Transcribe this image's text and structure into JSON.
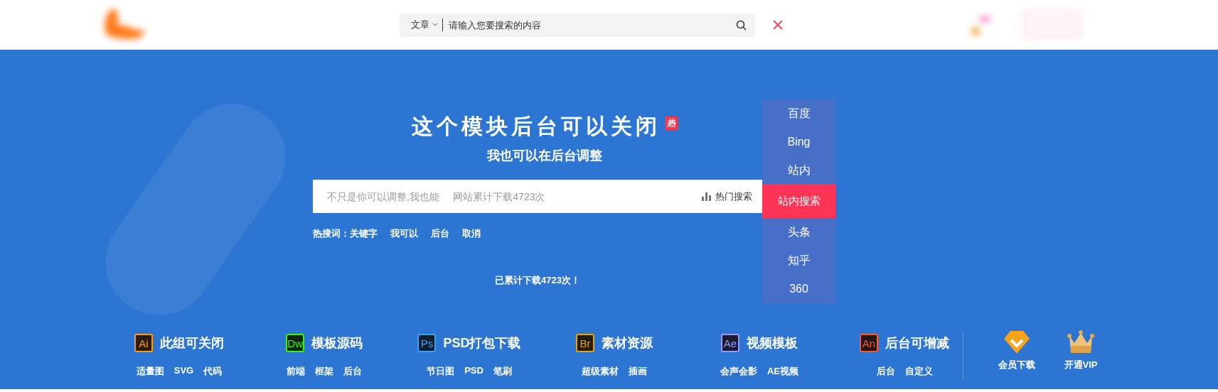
{
  "header": {
    "search": {
      "category": "文章",
      "placeholder": "请输入您要搜索的内容"
    }
  },
  "hero": {
    "title": "这个模块后台可以关闭",
    "title_badge": "热",
    "subtitle": "我也可以在后台调整",
    "search": {
      "placeholder": "不只是你可以调整,我也能     网站累计下载4723次",
      "hot_button": "热门搜索"
    },
    "engines": [
      {
        "label": "百度",
        "selected": false
      },
      {
        "label": "Bing",
        "selected": false
      },
      {
        "label": "站内",
        "selected": false
      },
      {
        "label": "站内搜索",
        "selected": true
      },
      {
        "label": "头条",
        "selected": false
      },
      {
        "label": "知乎",
        "selected": false
      },
      {
        "label": "360",
        "selected": false
      }
    ],
    "hot_words_label": "热搜词：",
    "hot_words": [
      "关键字",
      "我可以",
      "后台",
      "取消"
    ],
    "download_count": "已累计下载4723次！"
  },
  "categories": [
    {
      "badge": "Ai",
      "color": "#ff9a00",
      "title": "此组可关闭",
      "links": [
        "适量图",
        "SVG",
        "代码"
      ]
    },
    {
      "badge": "Dw",
      "color": "#35fa00",
      "title": "模板源码",
      "links": [
        "前端",
        "框架",
        "后台"
      ]
    },
    {
      "badge": "Ps",
      "color": "#31a8ff",
      "title": "PSD打包下载",
      "links": [
        "节日图",
        "PSD",
        "笔刷"
      ]
    },
    {
      "badge": "Br",
      "color": "#e8a300",
      "title": "素材资源",
      "links": [
        "超级素材",
        "插画"
      ]
    },
    {
      "badge": "Ae",
      "color": "#9999ff",
      "title": "视频模板",
      "links": [
        "会声会影",
        "AE视频"
      ]
    },
    {
      "badge": "An",
      "color": "#ff5a1f",
      "title": "后台可增减",
      "links": [
        "后台",
        "自定义"
      ]
    }
  ],
  "vip_links": [
    {
      "kind": "diamond",
      "label": "会员下载"
    },
    {
      "kind": "crown",
      "label": "开通VIP"
    }
  ]
}
